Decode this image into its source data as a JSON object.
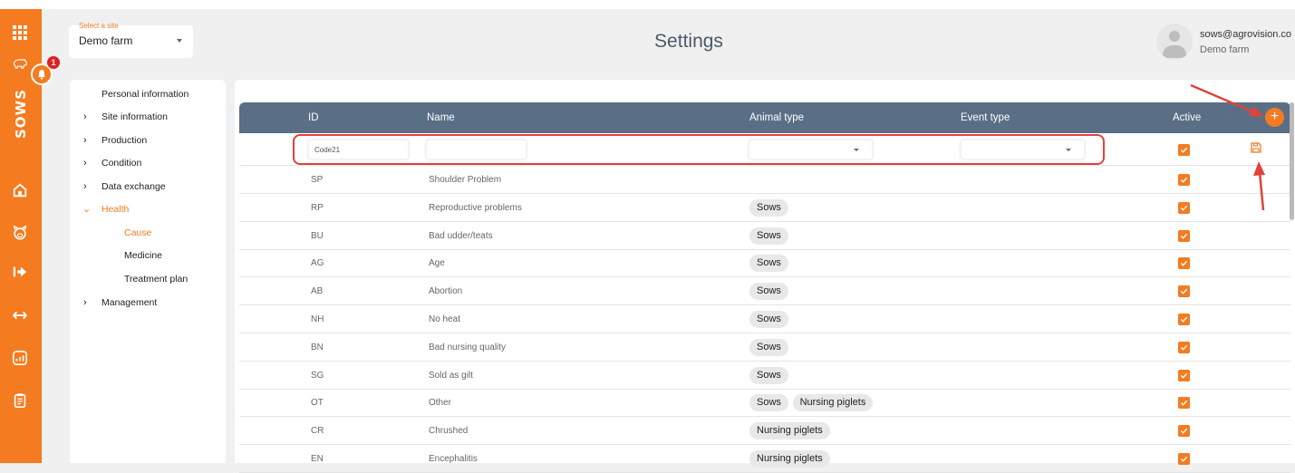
{
  "rail": {
    "icons": [
      "grid-icon",
      "pig-icon",
      "home-icon",
      "animal-icon",
      "exit-arrow-icon",
      "transfer-icon",
      "report-icon",
      "clipboard-icon"
    ],
    "brand": "SOWS",
    "notification_count": "1"
  },
  "site": {
    "label": "Select a site",
    "value": "Demo farm"
  },
  "page_title": "Settings",
  "user": {
    "email": "sows@agrovision.co",
    "farm": "Demo farm"
  },
  "nav": {
    "personal": "Personal information",
    "site_info": "Site information",
    "production": "Production",
    "condition": "Condition",
    "data_exchange": "Data exchange",
    "health": "Health",
    "cause": "Cause",
    "medicine": "Medicine",
    "treatment_plan": "Treatment plan",
    "management": "Management"
  },
  "table": {
    "headers": {
      "id": "ID",
      "name": "Name",
      "animal_type": "Animal type",
      "event_type": "Event type",
      "active": "Active"
    },
    "new_row": {
      "id_value": "Code21",
      "name_value": ""
    },
    "rows": [
      {
        "id": "SP",
        "name": "Shoulder Problem",
        "tags": []
      },
      {
        "id": "RP",
        "name": "Reproductive problems",
        "tags": [
          "Sows"
        ]
      },
      {
        "id": "BU",
        "name": "Bad udder/teats",
        "tags": [
          "Sows"
        ]
      },
      {
        "id": "AG",
        "name": "Age",
        "tags": [
          "Sows"
        ]
      },
      {
        "id": "AB",
        "name": "Abortion",
        "tags": [
          "Sows"
        ]
      },
      {
        "id": "NH",
        "name": "No heat",
        "tags": [
          "Sows"
        ]
      },
      {
        "id": "BN",
        "name": "Bad nursing quality",
        "tags": [
          "Sows"
        ]
      },
      {
        "id": "SG",
        "name": "Sold as gilt",
        "tags": [
          "Sows"
        ]
      },
      {
        "id": "OT",
        "name": "Other",
        "tags": [
          "Sows",
          "Nursing piglets"
        ]
      },
      {
        "id": "CR",
        "name": "Chrushed",
        "tags": [
          "Nursing piglets"
        ]
      },
      {
        "id": "EN",
        "name": "Encephalitis",
        "tags": [
          "Nursing piglets"
        ]
      }
    ]
  },
  "colors": {
    "accent": "#f47b20",
    "header": "#5a6f86",
    "highlight": "#e0433a"
  }
}
